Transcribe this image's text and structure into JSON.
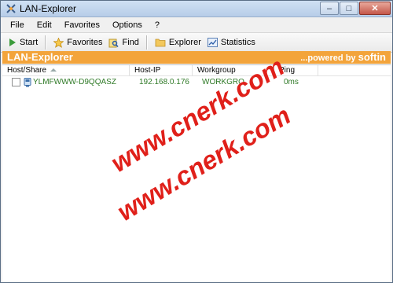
{
  "window": {
    "title": "LAN-Explorer",
    "controls": [
      "–",
      "□",
      "✕"
    ]
  },
  "menu": [
    "File",
    "Edit",
    "Favorites",
    "Options",
    "?"
  ],
  "toolbar": {
    "start": "Start",
    "favorites": "Favorites",
    "find": "Find",
    "explorer": "Explorer",
    "statistics": "Statistics"
  },
  "banner": {
    "title": "LAN-Explorer",
    "powered": "...powered by",
    "brand": "softin"
  },
  "columns": [
    "Host/Share",
    "Host-IP",
    "Workgroup",
    "Ping"
  ],
  "rows": [
    {
      "host": "YLMFWWW-D9QQASZ",
      "ip": "192.168.0.176",
      "workgroup": "WORKGRO",
      "ping": "0ms"
    }
  ],
  "watermark": [
    "www.cnerk.com",
    "www.cnerk.com"
  ],
  "colors": {
    "banner": "#f3a43b",
    "rowText": "#2f7a27",
    "watermark": "#e0201a"
  }
}
